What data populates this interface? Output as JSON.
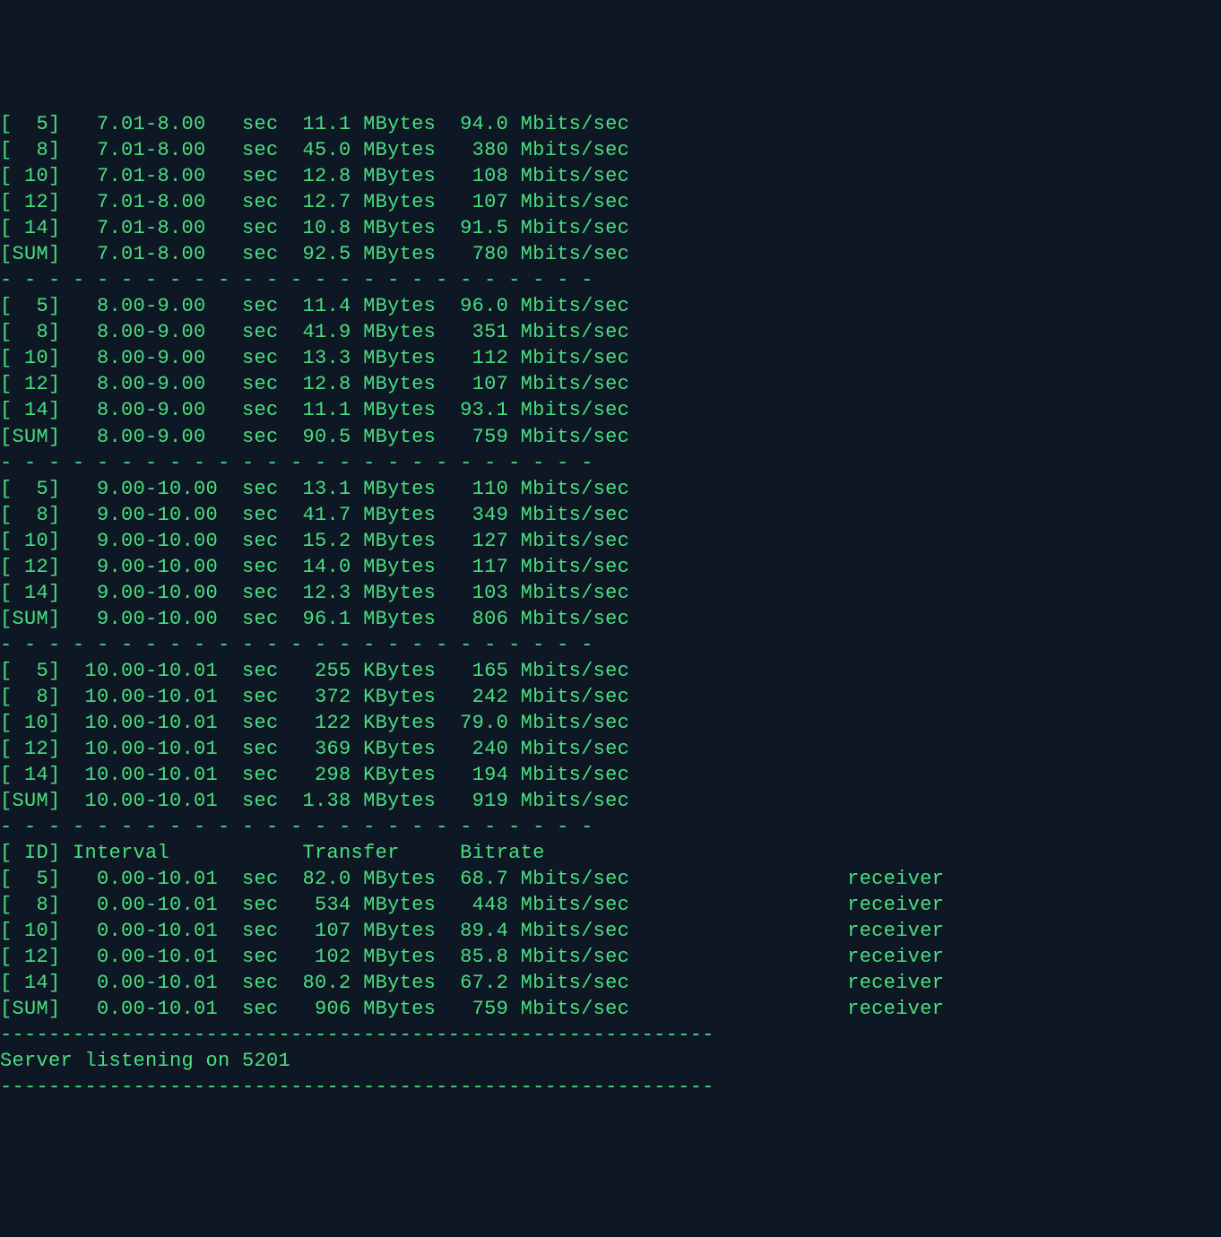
{
  "separator": "- - - - - - - - - - - - - - - - - - - - - - - - -",
  "long_separator": "-----------------------------------------------------------",
  "header_line": "[ ID] Interval           Transfer     Bitrate",
  "server_listening": "Server listening on 5201",
  "intervals": [
    {
      "rows": [
        {
          "id": "[  5]",
          "interval": "   7.01-8.00  ",
          "unit": "sec",
          "transfer": "  11.1 MBytes",
          "bitrate": "  94.0 Mbits/sec"
        },
        {
          "id": "[  8]",
          "interval": "   7.01-8.00  ",
          "unit": "sec",
          "transfer": "  45.0 MBytes",
          "bitrate": "   380 Mbits/sec"
        },
        {
          "id": "[ 10]",
          "interval": "   7.01-8.00  ",
          "unit": "sec",
          "transfer": "  12.8 MBytes",
          "bitrate": "   108 Mbits/sec"
        },
        {
          "id": "[ 12]",
          "interval": "   7.01-8.00  ",
          "unit": "sec",
          "transfer": "  12.7 MBytes",
          "bitrate": "   107 Mbits/sec"
        },
        {
          "id": "[ 14]",
          "interval": "   7.01-8.00  ",
          "unit": "sec",
          "transfer": "  10.8 MBytes",
          "bitrate": "  91.5 Mbits/sec"
        },
        {
          "id": "[SUM]",
          "interval": "   7.01-8.00  ",
          "unit": "sec",
          "transfer": "  92.5 MBytes",
          "bitrate": "   780 Mbits/sec"
        }
      ]
    },
    {
      "rows": [
        {
          "id": "[  5]",
          "interval": "   8.00-9.00  ",
          "unit": "sec",
          "transfer": "  11.4 MBytes",
          "bitrate": "  96.0 Mbits/sec"
        },
        {
          "id": "[  8]",
          "interval": "   8.00-9.00  ",
          "unit": "sec",
          "transfer": "  41.9 MBytes",
          "bitrate": "   351 Mbits/sec"
        },
        {
          "id": "[ 10]",
          "interval": "   8.00-9.00  ",
          "unit": "sec",
          "transfer": "  13.3 MBytes",
          "bitrate": "   112 Mbits/sec"
        },
        {
          "id": "[ 12]",
          "interval": "   8.00-9.00  ",
          "unit": "sec",
          "transfer": "  12.8 MBytes",
          "bitrate": "   107 Mbits/sec"
        },
        {
          "id": "[ 14]",
          "interval": "   8.00-9.00  ",
          "unit": "sec",
          "transfer": "  11.1 MBytes",
          "bitrate": "  93.1 Mbits/sec"
        },
        {
          "id": "[SUM]",
          "interval": "   8.00-9.00  ",
          "unit": "sec",
          "transfer": "  90.5 MBytes",
          "bitrate": "   759 Mbits/sec"
        }
      ]
    },
    {
      "rows": [
        {
          "id": "[  5]",
          "interval": "   9.00-10.00 ",
          "unit": "sec",
          "transfer": "  13.1 MBytes",
          "bitrate": "   110 Mbits/sec"
        },
        {
          "id": "[  8]",
          "interval": "   9.00-10.00 ",
          "unit": "sec",
          "transfer": "  41.7 MBytes",
          "bitrate": "   349 Mbits/sec"
        },
        {
          "id": "[ 10]",
          "interval": "   9.00-10.00 ",
          "unit": "sec",
          "transfer": "  15.2 MBytes",
          "bitrate": "   127 Mbits/sec"
        },
        {
          "id": "[ 12]",
          "interval": "   9.00-10.00 ",
          "unit": "sec",
          "transfer": "  14.0 MBytes",
          "bitrate": "   117 Mbits/sec"
        },
        {
          "id": "[ 14]",
          "interval": "   9.00-10.00 ",
          "unit": "sec",
          "transfer": "  12.3 MBytes",
          "bitrate": "   103 Mbits/sec"
        },
        {
          "id": "[SUM]",
          "interval": "   9.00-10.00 ",
          "unit": "sec",
          "transfer": "  96.1 MBytes",
          "bitrate": "   806 Mbits/sec"
        }
      ]
    },
    {
      "rows": [
        {
          "id": "[  5]",
          "interval": "  10.00-10.01 ",
          "unit": "sec",
          "transfer": "   255 KBytes",
          "bitrate": "   165 Mbits/sec"
        },
        {
          "id": "[  8]",
          "interval": "  10.00-10.01 ",
          "unit": "sec",
          "transfer": "   372 KBytes",
          "bitrate": "   242 Mbits/sec"
        },
        {
          "id": "[ 10]",
          "interval": "  10.00-10.01 ",
          "unit": "sec",
          "transfer": "   122 KBytes",
          "bitrate": "  79.0 Mbits/sec"
        },
        {
          "id": "[ 12]",
          "interval": "  10.00-10.01 ",
          "unit": "sec",
          "transfer": "   369 KBytes",
          "bitrate": "   240 Mbits/sec"
        },
        {
          "id": "[ 14]",
          "interval": "  10.00-10.01 ",
          "unit": "sec",
          "transfer": "   298 KBytes",
          "bitrate": "   194 Mbits/sec"
        },
        {
          "id": "[SUM]",
          "interval": "  10.00-10.01 ",
          "unit": "sec",
          "transfer": "  1.38 MBytes",
          "bitrate": "   919 Mbits/sec"
        }
      ]
    }
  ],
  "summary": {
    "rows": [
      {
        "id": "[  5]",
        "interval": "   0.00-10.01 ",
        "unit": "sec",
        "transfer": "  82.0 MBytes",
        "bitrate": "  68.7 Mbits/sec",
        "role": "                  receiver"
      },
      {
        "id": "[  8]",
        "interval": "   0.00-10.01 ",
        "unit": "sec",
        "transfer": "   534 MBytes",
        "bitrate": "   448 Mbits/sec",
        "role": "                  receiver"
      },
      {
        "id": "[ 10]",
        "interval": "   0.00-10.01 ",
        "unit": "sec",
        "transfer": "   107 MBytes",
        "bitrate": "  89.4 Mbits/sec",
        "role": "                  receiver"
      },
      {
        "id": "[ 12]",
        "interval": "   0.00-10.01 ",
        "unit": "sec",
        "transfer": "   102 MBytes",
        "bitrate": "  85.8 Mbits/sec",
        "role": "                  receiver"
      },
      {
        "id": "[ 14]",
        "interval": "   0.00-10.01 ",
        "unit": "sec",
        "transfer": "  80.2 MBytes",
        "bitrate": "  67.2 Mbits/sec",
        "role": "                  receiver"
      },
      {
        "id": "[SUM]",
        "interval": "   0.00-10.01 ",
        "unit": "sec",
        "transfer": "   906 MBytes",
        "bitrate": "   759 Mbits/sec",
        "role": "                  receiver"
      }
    ]
  }
}
